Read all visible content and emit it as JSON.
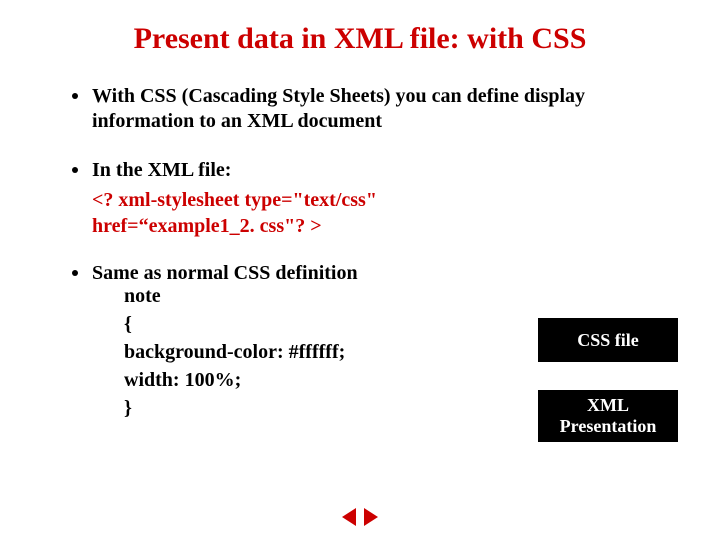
{
  "title": "Present data in XML file: with CSS",
  "bullets": {
    "b1": "With CSS (Cascading Style Sheets) you can define display information to an XML document",
    "b2": "In the XML file:",
    "b3": "Same as normal CSS definition"
  },
  "code": {
    "line1": "<? xml-stylesheet type=\"text/css\"",
    "line2": "href=“example1_2. css\"? >"
  },
  "cssdef": {
    "l1": "note",
    "l2": "{",
    "l3": "background-color: #ffffff;",
    "l4": "width: 100%;",
    "l5": "}"
  },
  "buttons": {
    "cssfile": "CSS file",
    "xmlpres": "XML Presentation"
  }
}
